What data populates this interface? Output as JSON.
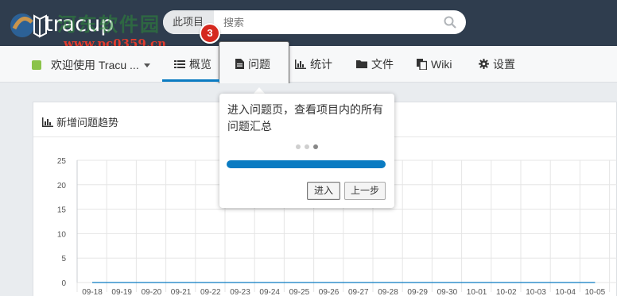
{
  "header": {
    "brand": "tracup",
    "watermark_cn": "河东软件园",
    "watermark_url": "www.pc0359.cn",
    "search": {
      "scope": "此项目",
      "placeholder": "搜索"
    },
    "step_badge": "3"
  },
  "subnav": {
    "project_name": "欢迎使用 Tracu ...",
    "tabs": [
      {
        "label": "概览",
        "icon": "list-icon"
      },
      {
        "label": "问题",
        "icon": "document-icon"
      },
      {
        "label": "统计",
        "icon": "bar-chart-icon"
      },
      {
        "label": "文件",
        "icon": "folder-icon"
      },
      {
        "label": "Wiki",
        "icon": "copy-icon"
      },
      {
        "label": "设置",
        "icon": "gear-icon"
      }
    ],
    "active_tab": "概览",
    "highlighted_tab": "问题"
  },
  "panel": {
    "title": "新增问题趋势"
  },
  "popover": {
    "text": "进入问题页，查看项目内的所有问题汇总",
    "step_of": [
      3,
      3
    ],
    "progress": 1.0,
    "enter_label": "进入",
    "prev_label": "上一步"
  },
  "chart_data": {
    "type": "line",
    "x": [
      "09-18",
      "09-19",
      "09-20",
      "09-21",
      "09-22",
      "09-23",
      "09-24",
      "09-25",
      "09-26",
      "09-27",
      "09-28",
      "09-29",
      "09-30",
      "10-01",
      "10-02",
      "10-03",
      "10-04",
      "10-05"
    ],
    "series": [
      {
        "values": [
          0,
          0,
          0,
          0,
          0,
          0,
          0,
          0,
          0,
          0,
          0,
          0,
          0,
          0,
          0,
          0,
          0,
          0
        ]
      }
    ],
    "yticks": [
      0,
      5,
      10,
      15,
      20,
      25
    ],
    "ylim": [
      0,
      25
    ],
    "grid": true,
    "colors": {
      "line": "#0a7bc2",
      "grid": "#e5e5e5"
    }
  },
  "colors": {
    "topbar": "#2f3d4e",
    "accent": "#0a7bc2",
    "badge": "#d5291f",
    "project_dot": "#8bc34a"
  }
}
